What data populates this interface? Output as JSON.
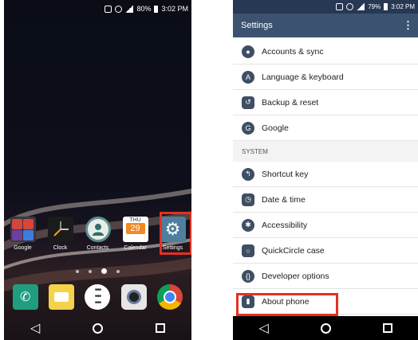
{
  "left_phone": {
    "status": {
      "battery": "80%",
      "time": "3:02 PM"
    },
    "apps": [
      {
        "label": "Google"
      },
      {
        "label": "Clock"
      },
      {
        "label": "Contacts"
      },
      {
        "label": "Calendar",
        "day": "THU",
        "date": "29"
      },
      {
        "label": "Settings"
      }
    ],
    "dock_icons": [
      "phone-icon",
      "messaging-icon",
      "apps-icon",
      "camera-icon",
      "chrome-icon"
    ],
    "highlight_color": "#e53020"
  },
  "right_phone": {
    "status": {
      "battery": "79%",
      "time": "3:02 PM"
    },
    "title": "Settings",
    "items_top": [
      {
        "label": "Accounts & sync",
        "icon": "person-icon"
      },
      {
        "label": "Language & keyboard",
        "icon": "language-icon"
      },
      {
        "label": "Backup & reset",
        "icon": "backup-icon"
      },
      {
        "label": "Google",
        "icon": "google-icon"
      }
    ],
    "section": "SYSTEM",
    "items_system": [
      {
        "label": "Shortcut key",
        "icon": "shortcut-icon"
      },
      {
        "label": "Date & time",
        "icon": "clock-icon"
      },
      {
        "label": "Accessibility",
        "icon": "accessibility-icon"
      },
      {
        "label": "QuickCircle case",
        "icon": "quickcircle-icon"
      },
      {
        "label": "Developer options",
        "icon": "developer-icon"
      },
      {
        "label": "About phone",
        "icon": "about-icon"
      }
    ]
  }
}
